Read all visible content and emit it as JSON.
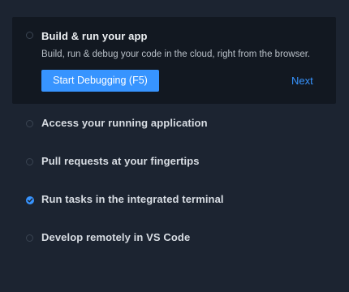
{
  "walkthrough": {
    "active_step": {
      "title": "Build & run your app",
      "description": "Build, run & debug your code in the cloud, right from the browser.",
      "primary_button": "Start Debugging (F5)",
      "next_link": "Next",
      "checked": false
    },
    "steps": [
      {
        "title": "Access your running application",
        "checked": false
      },
      {
        "title": "Pull requests at your fingertips",
        "checked": false
      },
      {
        "title": "Run tasks in the integrated terminal",
        "checked": true
      },
      {
        "title": "Develop remotely in VS Code",
        "checked": false
      }
    ]
  },
  "colors": {
    "background": "#1c2431",
    "active_step_background": "#121821",
    "accent": "#3794ff",
    "checkbox_border": "#3a4452"
  },
  "icons": {
    "unchecked": "circle-outline-icon",
    "checked": "check-circle-icon"
  }
}
